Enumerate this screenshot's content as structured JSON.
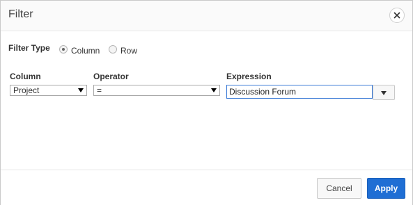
{
  "dialog": {
    "title": "Filter",
    "close_icon": "close-icon"
  },
  "filter_type": {
    "label": "Filter Type",
    "options": [
      {
        "label": "Column",
        "checked": true
      },
      {
        "label": "Row",
        "checked": false
      }
    ]
  },
  "fields": {
    "column": {
      "label": "Column",
      "value": "Project"
    },
    "operator": {
      "label": "Operator",
      "value": "="
    },
    "expression": {
      "label": "Expression",
      "value": "Discussion Forum"
    }
  },
  "footer": {
    "cancel_label": "Cancel",
    "apply_label": "Apply"
  },
  "colors": {
    "accent": "#1f6ed4",
    "focus_border": "#3a7ad6"
  }
}
